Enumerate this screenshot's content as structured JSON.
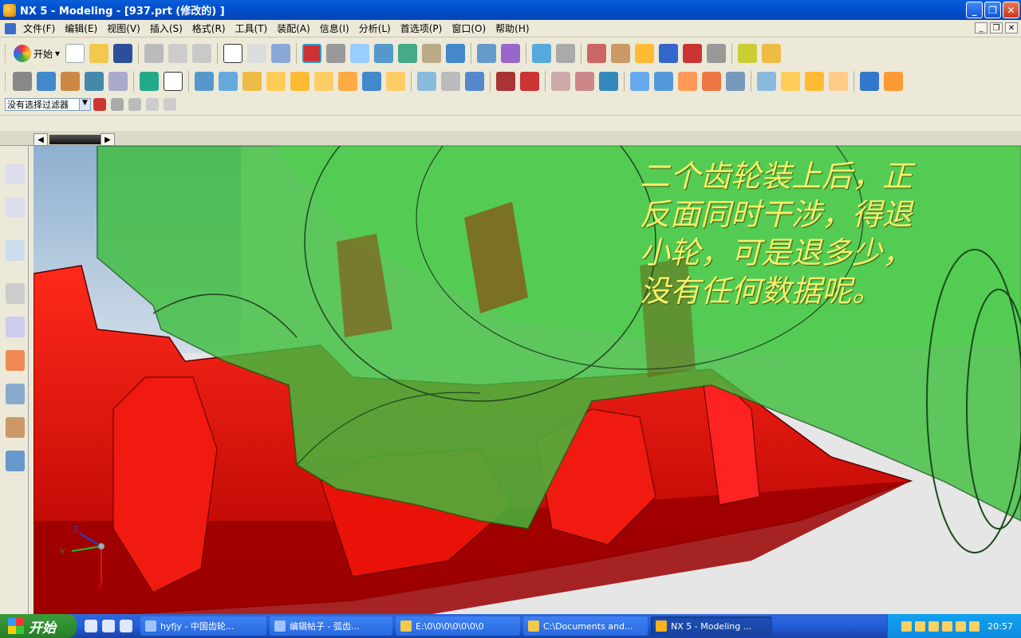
{
  "window": {
    "title": "NX 5 - Modeling - [937.prt (修改的) ]"
  },
  "menu": [
    {
      "label": "文件(F)"
    },
    {
      "label": "编辑(E)"
    },
    {
      "label": "视图(V)"
    },
    {
      "label": "插入(S)"
    },
    {
      "label": "格式(R)"
    },
    {
      "label": "工具(T)"
    },
    {
      "label": "装配(A)"
    },
    {
      "label": "信息(I)"
    },
    {
      "label": "分析(L)"
    },
    {
      "label": "首选项(P)"
    },
    {
      "label": "窗口(O)"
    },
    {
      "label": "帮助(H)"
    }
  ],
  "toolbar": {
    "start_label": "开始"
  },
  "selection": {
    "filter_value": "没有选择过滤器"
  },
  "overlay": {
    "lines": [
      "二个齿轮装上后，正",
      "反面同时干涉，得退",
      "小轮，可是退多少，",
      "没有任何数据呢。"
    ]
  },
  "triad": {
    "x_label": "X",
    "y_label": "Y",
    "z_label": "Z"
  },
  "taskbar": {
    "start_label": "开始",
    "tasks": [
      {
        "label": "hyfjy - 中国齿轮..."
      },
      {
        "label": "编辑帖子 - 弧齿..."
      },
      {
        "label": "E:\\0\\0\\0\\0\\0\\0\\0"
      },
      {
        "label": "C:\\Documents and..."
      },
      {
        "label": "NX 5 - Modeling ..."
      }
    ],
    "clock": "20:57"
  },
  "colors": {
    "gear_red": "#ee1010",
    "gear_green": "#3fbf3f",
    "overlay_text": "#f4ef6a"
  }
}
